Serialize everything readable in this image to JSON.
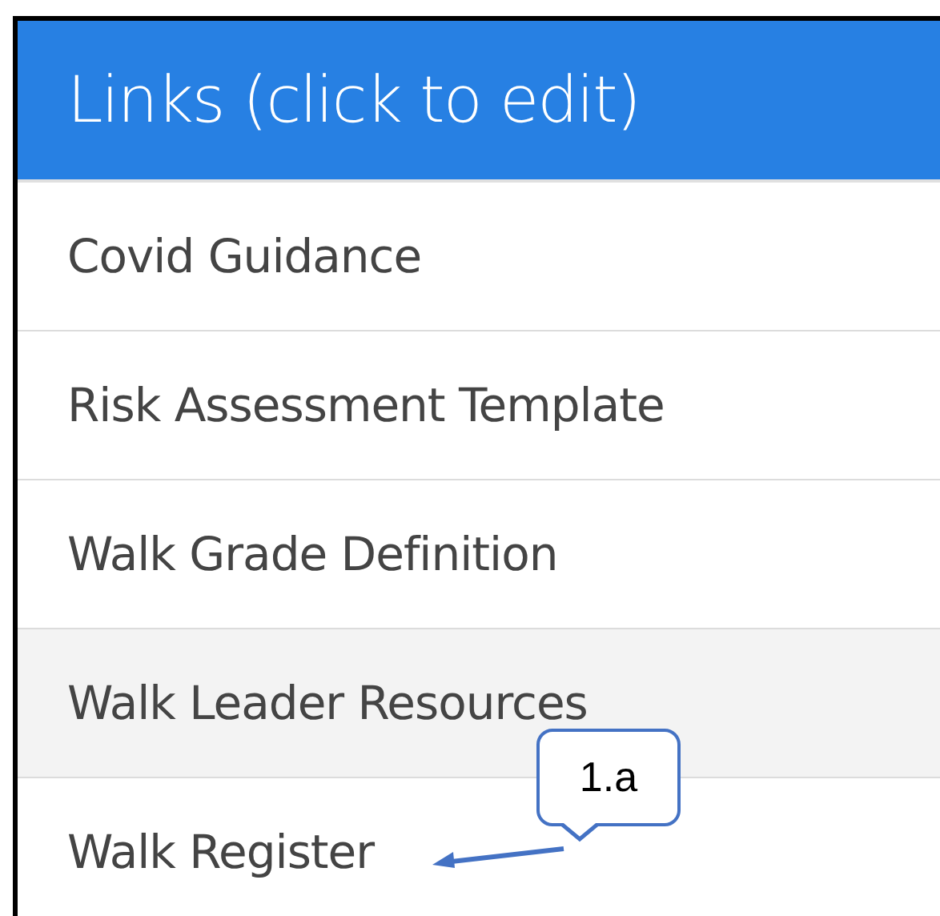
{
  "panel": {
    "title": "Links (click to edit)"
  },
  "links": [
    {
      "label": "Covid Guidance",
      "highlighted": false
    },
    {
      "label": "Risk Assessment Template",
      "highlighted": false
    },
    {
      "label": "Walk Grade Definition",
      "highlighted": false
    },
    {
      "label": "Walk Leader Resources",
      "highlighted": true
    },
    {
      "label": "Walk Register",
      "highlighted": false
    }
  ],
  "callout": {
    "label": "1.a"
  }
}
